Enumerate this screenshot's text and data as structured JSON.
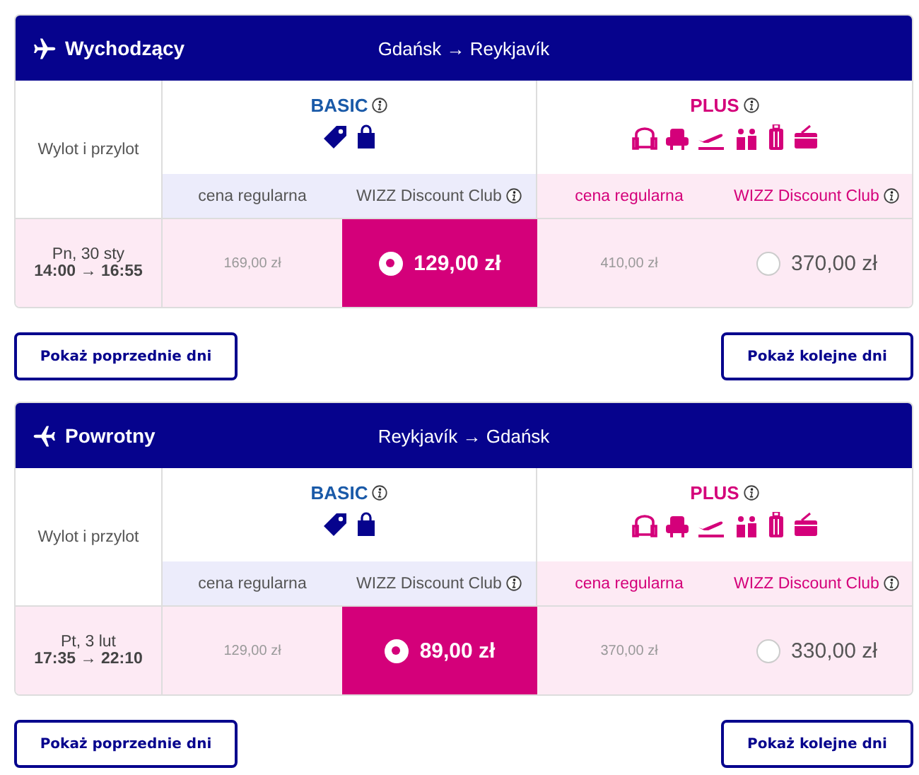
{
  "flights": [
    {
      "title": "Wychodzący",
      "route": "Gdańsk → Reykjavík",
      "row_label": "Wylot i przylot",
      "date": "Pn, 30 sty",
      "times": "14:00 → 16:55",
      "tiers": [
        {
          "name": "BASIC",
          "kind": "basic",
          "regular_label": "cena regularna",
          "club_label": "WIZZ Discount Club",
          "regular_price": "169,00 zł",
          "club_price": "129,00 zł",
          "selected": true
        },
        {
          "name": "PLUS",
          "kind": "plus",
          "regular_label": "cena regularna",
          "club_label": "WIZZ Discount Club",
          "regular_price": "410,00 zł",
          "club_price": "370,00 zł",
          "selected": false
        }
      ],
      "buttons": [
        "Pokaż poprzednie dni",
        "Pokaż kolejne dni"
      ]
    },
    {
      "title": "Powrotny",
      "route": "Reykjavík → Gdańsk",
      "row_label": "Wylot i przylot",
      "date": "Pt, 3 lut",
      "times": "17:35 → 22:10",
      "tiers": [
        {
          "name": "BASIC",
          "kind": "basic",
          "regular_label": "cena regularna",
          "club_label": "WIZZ Discount Club",
          "regular_price": "129,00 zł",
          "club_price": "89,00 zł",
          "selected": true
        },
        {
          "name": "PLUS",
          "kind": "plus",
          "regular_label": "cena regularna",
          "club_label": "WIZZ Discount Club",
          "regular_price": "370,00 zł",
          "club_price": "330,00 zł",
          "selected": false
        }
      ],
      "buttons": [
        "Pokaż poprzednie dni",
        "Pokaż kolejne dni"
      ]
    }
  ]
}
